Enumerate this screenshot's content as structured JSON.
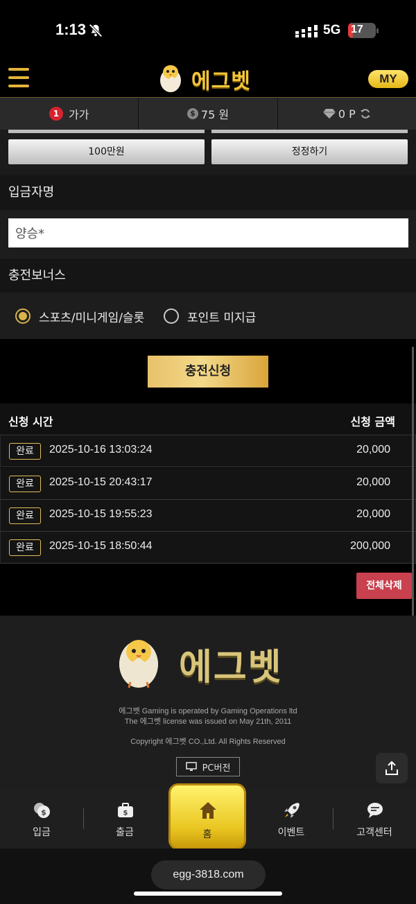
{
  "status_bar": {
    "time": "1:13",
    "network": "5G",
    "battery_level": "17"
  },
  "header": {
    "logo_text": "에그벳",
    "my_label": "MY"
  },
  "info_bar": {
    "level_number": "1",
    "nickname": "가가",
    "money": "75 원",
    "points": "0 P"
  },
  "amount_buttons": [
    {
      "label": "100만원"
    },
    {
      "label": "정정하기"
    }
  ],
  "depositor": {
    "label": "입금자명",
    "value": "양승*"
  },
  "bonus": {
    "label": "충전보너스",
    "options": [
      {
        "label": "스포츠/미니게임/슬롯",
        "checked": true
      },
      {
        "label": "포인트 미지급",
        "checked": false
      }
    ]
  },
  "apply_label": "충전신청",
  "history": {
    "col_time": "신청 시간",
    "col_amount": "신청 금액",
    "rows": [
      {
        "status": "완료",
        "date": "2025-10-16 13:03:24",
        "amount": "20,000"
      },
      {
        "status": "완료",
        "date": "2025-10-15 20:43:17",
        "amount": "20,000"
      },
      {
        "status": "완료",
        "date": "2025-10-15 19:55:23",
        "amount": "20,000"
      },
      {
        "status": "완료",
        "date": "2025-10-15 18:50:44",
        "amount": "200,000"
      }
    ]
  },
  "delete_all_label": "전체삭제",
  "footer": {
    "logo_text": "에그벳",
    "line1": "에그벳 Gaming is operated by Gaming Operations ltd",
    "line2": "The 에그벳 license was issued on May 21th, 2011",
    "copyright": "Copyright 에그벳 CO.,Ltd. All Rights Reserved",
    "pc_version": "PC버전"
  },
  "nav": {
    "deposit": "입금",
    "withdraw": "출금",
    "home": "홈",
    "event": "이벤트",
    "support": "고객센터"
  },
  "url": "egg-3818.com",
  "colors": {
    "accent_gold": "#e6b339",
    "delete_red": "#c9404e",
    "badge_border": "#e0c15a"
  }
}
